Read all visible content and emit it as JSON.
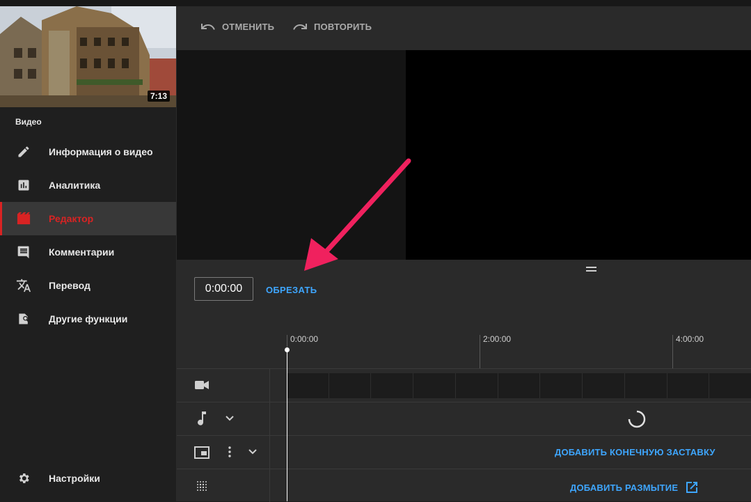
{
  "sidebar": {
    "thumbnail_duration": "7:13",
    "section_label": "Видео",
    "items": [
      {
        "label": "Информация о видео",
        "icon": "pencil-icon"
      },
      {
        "label": "Аналитика",
        "icon": "analytics-icon"
      },
      {
        "label": "Редактор",
        "icon": "editor-clapper-icon",
        "active": true
      },
      {
        "label": "Комментарии",
        "icon": "comments-icon"
      },
      {
        "label": "Перевод",
        "icon": "translate-icon"
      },
      {
        "label": "Другие функции",
        "icon": "other-features-icon"
      }
    ],
    "settings_label": "Настройки"
  },
  "toolbar": {
    "undo_label": "ОТМЕНИТЬ",
    "redo_label": "ПОВТОРИТЬ"
  },
  "editor": {
    "timecode": "0:00:00",
    "trim_label": "ОБРЕЗАТЬ",
    "ruler_labels": [
      "0:00:00",
      "2:00:00",
      "4:00:00"
    ],
    "add_end_screen_label": "ДОБАВИТЬ КОНЕЧНУЮ ЗАСТАВКУ",
    "add_blur_label": "ДОБАВИТЬ РАЗМЫТИЕ"
  },
  "colors": {
    "accent_red": "#d92323",
    "link_blue": "#3ea6ff",
    "annotation_arrow": "#f0215e"
  }
}
